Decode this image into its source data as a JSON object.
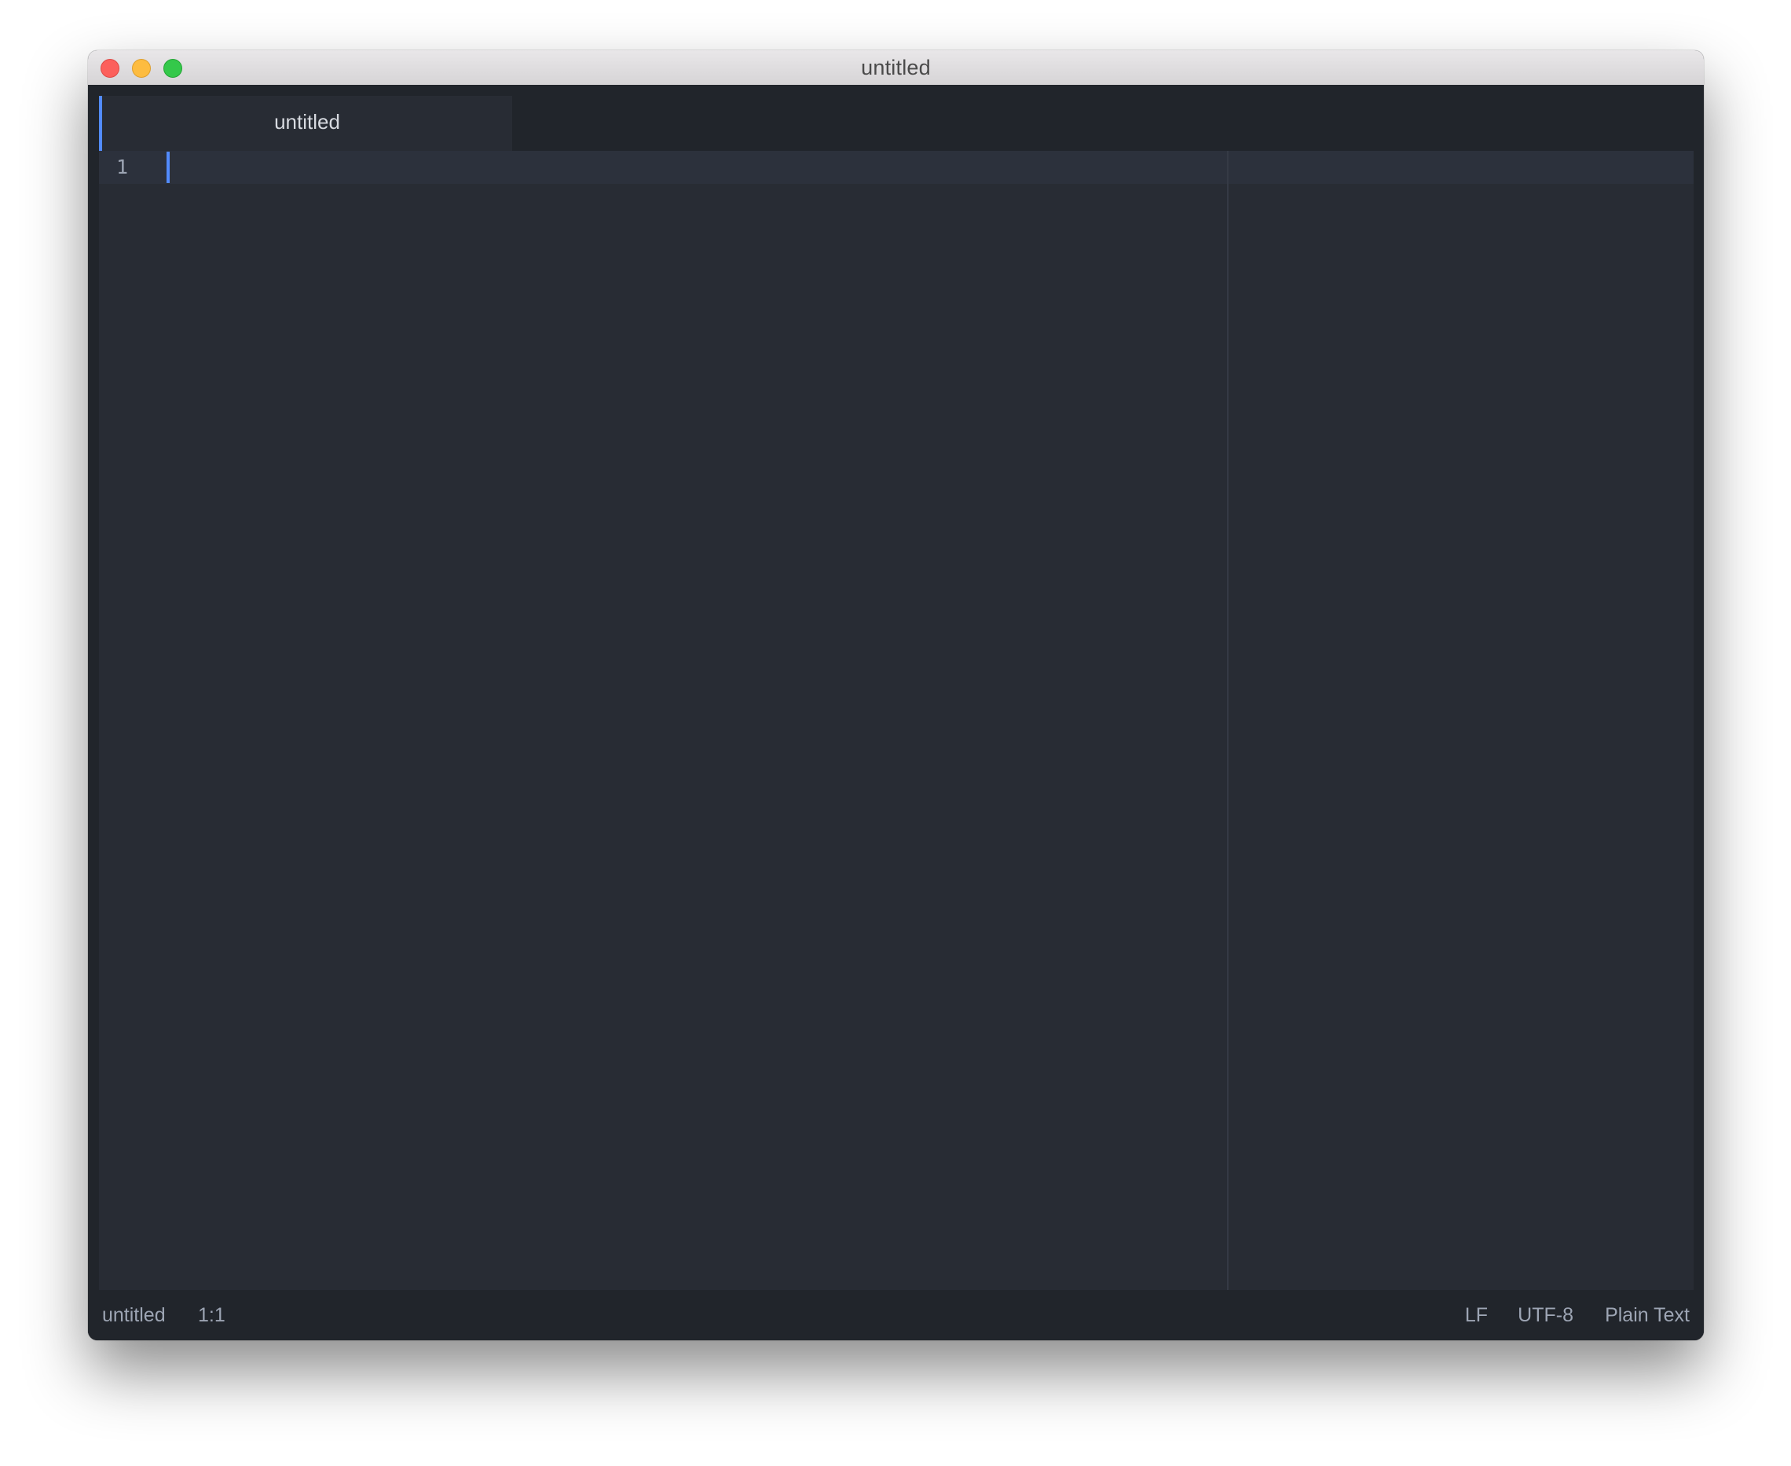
{
  "window": {
    "title": "untitled"
  },
  "tabs": [
    {
      "label": "untitled",
      "active": true
    }
  ],
  "editor": {
    "line_numbers": [
      "1"
    ],
    "content": "",
    "accent_color": "#528bff",
    "background_color": "#282c34"
  },
  "status_bar": {
    "file_name": "untitled",
    "cursor_position": "1:1",
    "line_ending": "LF",
    "encoding": "UTF-8",
    "grammar": "Plain Text"
  }
}
